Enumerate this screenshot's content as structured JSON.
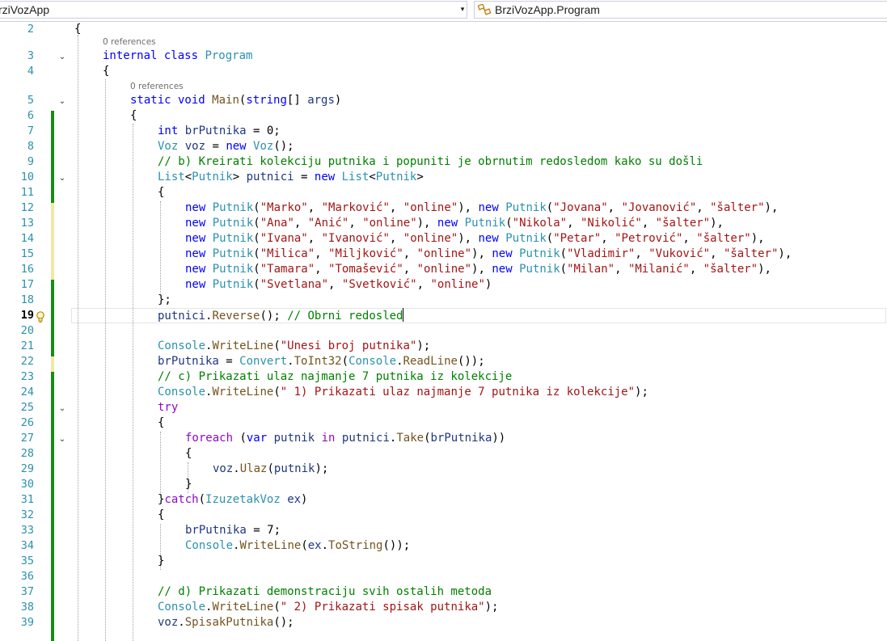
{
  "navbar": {
    "project": "rziVozApp",
    "dropdown_arrow": "▾",
    "class_member": "BrziVozApp.Program",
    "class_icon": "class-icon"
  },
  "codelens": {
    "program_refs": "0 references",
    "main_refs": "0 references"
  },
  "lines": [
    {
      "num": "2",
      "tokens": [
        {
          "t": "{",
          "c": ""
        }
      ]
    },
    {
      "num": "3",
      "tokens": [
        {
          "t": "internal class ",
          "c": "k"
        },
        {
          "t": "Program",
          "c": "t"
        }
      ]
    },
    {
      "num": "4",
      "tokens": [
        {
          "t": "{",
          "c": ""
        }
      ]
    },
    {
      "num": "5",
      "tokens": [
        {
          "t": "static void ",
          "c": "k"
        },
        {
          "t": "Main",
          "c": "m"
        },
        {
          "t": "(",
          "c": ""
        },
        {
          "t": "string",
          "c": "k"
        },
        {
          "t": "[] ",
          "c": ""
        },
        {
          "t": "args",
          "c": "v"
        },
        {
          "t": ")",
          "c": ""
        }
      ]
    },
    {
      "num": "6",
      "tokens": [
        {
          "t": "{",
          "c": ""
        }
      ]
    },
    {
      "num": "7",
      "tokens": [
        {
          "t": "int ",
          "c": "k"
        },
        {
          "t": "brPutnika",
          "c": "v"
        },
        {
          "t": " = 0;",
          "c": ""
        }
      ]
    },
    {
      "num": "8",
      "tokens": [
        {
          "t": "Voz ",
          "c": "t"
        },
        {
          "t": "voz",
          "c": "v"
        },
        {
          "t": " = ",
          "c": ""
        },
        {
          "t": "new ",
          "c": "k"
        },
        {
          "t": "Voz",
          "c": "t"
        },
        {
          "t": "();",
          "c": ""
        }
      ]
    },
    {
      "num": "9",
      "tokens": [
        {
          "t": "// b) Kreirati kolekciju putnika i popuniti je obrnutim redosledom kako su došli",
          "c": "c"
        }
      ]
    },
    {
      "num": "10",
      "tokens": [
        {
          "t": "List",
          "c": "t"
        },
        {
          "t": "<",
          "c": ""
        },
        {
          "t": "Putnik",
          "c": "t"
        },
        {
          "t": "> ",
          "c": ""
        },
        {
          "t": "putnici",
          "c": "v"
        },
        {
          "t": " = ",
          "c": ""
        },
        {
          "t": "new ",
          "c": "k"
        },
        {
          "t": "List",
          "c": "t"
        },
        {
          "t": "<",
          "c": ""
        },
        {
          "t": "Putnik",
          "c": "t"
        },
        {
          "t": ">",
          "c": ""
        }
      ]
    },
    {
      "num": "11",
      "tokens": [
        {
          "t": "{",
          "c": ""
        }
      ]
    },
    {
      "num": "12",
      "tokens": [
        {
          "t": "new ",
          "c": "k"
        },
        {
          "t": "Putnik",
          "c": "t"
        },
        {
          "t": "(",
          "c": ""
        },
        {
          "t": "\"Marko\"",
          "c": "s"
        },
        {
          "t": ", ",
          "c": ""
        },
        {
          "t": "\"Marković\"",
          "c": "s"
        },
        {
          "t": ", ",
          "c": ""
        },
        {
          "t": "\"online\"",
          "c": "s"
        },
        {
          "t": "), ",
          "c": ""
        },
        {
          "t": "new ",
          "c": "k"
        },
        {
          "t": "Putnik",
          "c": "t"
        },
        {
          "t": "(",
          "c": ""
        },
        {
          "t": "\"Jovana\"",
          "c": "s"
        },
        {
          "t": ", ",
          "c": ""
        },
        {
          "t": "\"Jovanović\"",
          "c": "s"
        },
        {
          "t": ", ",
          "c": ""
        },
        {
          "t": "\"šalter\"",
          "c": "s"
        },
        {
          "t": "),",
          "c": ""
        }
      ]
    },
    {
      "num": "13",
      "tokens": [
        {
          "t": "new ",
          "c": "k"
        },
        {
          "t": "Putnik",
          "c": "t"
        },
        {
          "t": "(",
          "c": ""
        },
        {
          "t": "\"Ana\"",
          "c": "s"
        },
        {
          "t": ", ",
          "c": ""
        },
        {
          "t": "\"Anić\"",
          "c": "s"
        },
        {
          "t": ", ",
          "c": ""
        },
        {
          "t": "\"online\"",
          "c": "s"
        },
        {
          "t": "), ",
          "c": ""
        },
        {
          "t": "new ",
          "c": "k"
        },
        {
          "t": "Putnik",
          "c": "t"
        },
        {
          "t": "(",
          "c": ""
        },
        {
          "t": "\"Nikola\"",
          "c": "s"
        },
        {
          "t": ", ",
          "c": ""
        },
        {
          "t": "\"Nikolić\"",
          "c": "s"
        },
        {
          "t": ", ",
          "c": ""
        },
        {
          "t": "\"šalter\"",
          "c": "s"
        },
        {
          "t": "),",
          "c": ""
        }
      ]
    },
    {
      "num": "14",
      "tokens": [
        {
          "t": "new ",
          "c": "k"
        },
        {
          "t": "Putnik",
          "c": "t"
        },
        {
          "t": "(",
          "c": ""
        },
        {
          "t": "\"Ivana\"",
          "c": "s"
        },
        {
          "t": ", ",
          "c": ""
        },
        {
          "t": "\"Ivanović\"",
          "c": "s"
        },
        {
          "t": ", ",
          "c": ""
        },
        {
          "t": "\"online\"",
          "c": "s"
        },
        {
          "t": "), ",
          "c": ""
        },
        {
          "t": "new ",
          "c": "k"
        },
        {
          "t": "Putnik",
          "c": "t"
        },
        {
          "t": "(",
          "c": ""
        },
        {
          "t": "\"Petar\"",
          "c": "s"
        },
        {
          "t": ", ",
          "c": ""
        },
        {
          "t": "\"Petrović\"",
          "c": "s"
        },
        {
          "t": ", ",
          "c": ""
        },
        {
          "t": "\"šalter\"",
          "c": "s"
        },
        {
          "t": "),",
          "c": ""
        }
      ]
    },
    {
      "num": "15",
      "tokens": [
        {
          "t": "new ",
          "c": "k"
        },
        {
          "t": "Putnik",
          "c": "t"
        },
        {
          "t": "(",
          "c": ""
        },
        {
          "t": "\"Milica\"",
          "c": "s"
        },
        {
          "t": ", ",
          "c": ""
        },
        {
          "t": "\"Miljković\"",
          "c": "s"
        },
        {
          "t": ", ",
          "c": ""
        },
        {
          "t": "\"online\"",
          "c": "s"
        },
        {
          "t": "), ",
          "c": ""
        },
        {
          "t": "new ",
          "c": "k"
        },
        {
          "t": "Putnik",
          "c": "t"
        },
        {
          "t": "(",
          "c": ""
        },
        {
          "t": "\"Vladimir\"",
          "c": "s"
        },
        {
          "t": ", ",
          "c": ""
        },
        {
          "t": "\"Vuković\"",
          "c": "s"
        },
        {
          "t": ", ",
          "c": ""
        },
        {
          "t": "\"šalter\"",
          "c": "s"
        },
        {
          "t": "),",
          "c": ""
        }
      ]
    },
    {
      "num": "16",
      "tokens": [
        {
          "t": "new ",
          "c": "k"
        },
        {
          "t": "Putnik",
          "c": "t"
        },
        {
          "t": "(",
          "c": ""
        },
        {
          "t": "\"Tamara\"",
          "c": "s"
        },
        {
          "t": ", ",
          "c": ""
        },
        {
          "t": "\"Tomašević\"",
          "c": "s"
        },
        {
          "t": ", ",
          "c": ""
        },
        {
          "t": "\"online\"",
          "c": "s"
        },
        {
          "t": "), ",
          "c": ""
        },
        {
          "t": "new ",
          "c": "k"
        },
        {
          "t": "Putnik",
          "c": "t"
        },
        {
          "t": "(",
          "c": ""
        },
        {
          "t": "\"Milan\"",
          "c": "s"
        },
        {
          "t": ", ",
          "c": ""
        },
        {
          "t": "\"Milanić\"",
          "c": "s"
        },
        {
          "t": ", ",
          "c": ""
        },
        {
          "t": "\"šalter\"",
          "c": "s"
        },
        {
          "t": "),",
          "c": ""
        }
      ]
    },
    {
      "num": "17",
      "tokens": [
        {
          "t": "new ",
          "c": "k"
        },
        {
          "t": "Putnik",
          "c": "t"
        },
        {
          "t": "(",
          "c": ""
        },
        {
          "t": "\"Svetlana\"",
          "c": "s"
        },
        {
          "t": ", ",
          "c": ""
        },
        {
          "t": "\"Svetković\"",
          "c": "s"
        },
        {
          "t": ", ",
          "c": ""
        },
        {
          "t": "\"online\"",
          "c": "s"
        },
        {
          "t": ")",
          "c": ""
        }
      ]
    },
    {
      "num": "18",
      "tokens": [
        {
          "t": "};",
          "c": ""
        }
      ]
    },
    {
      "num": "19",
      "tokens": [
        {
          "t": "putnici",
          "c": "v"
        },
        {
          "t": ".",
          "c": ""
        },
        {
          "t": "Reverse",
          "c": "m"
        },
        {
          "t": "(); ",
          "c": ""
        },
        {
          "t": "// Obrni redosled",
          "c": "c"
        }
      ]
    },
    {
      "num": "20",
      "tokens": []
    },
    {
      "num": "21",
      "tokens": [
        {
          "t": "Console",
          "c": "t"
        },
        {
          "t": ".",
          "c": ""
        },
        {
          "t": "WriteLine",
          "c": "m"
        },
        {
          "t": "(",
          "c": ""
        },
        {
          "t": "\"Unesi broj putnika\"",
          "c": "s"
        },
        {
          "t": ");",
          "c": ""
        }
      ]
    },
    {
      "num": "22",
      "tokens": [
        {
          "t": "brPutnika",
          "c": "v"
        },
        {
          "t": " = ",
          "c": ""
        },
        {
          "t": "Convert",
          "c": "t"
        },
        {
          "t": ".",
          "c": ""
        },
        {
          "t": "ToInt32",
          "c": "m"
        },
        {
          "t": "(",
          "c": ""
        },
        {
          "t": "Console",
          "c": "t"
        },
        {
          "t": ".",
          "c": ""
        },
        {
          "t": "ReadLine",
          "c": "m"
        },
        {
          "t": "());",
          "c": ""
        }
      ]
    },
    {
      "num": "23",
      "tokens": [
        {
          "t": "// c) Prikazati ulaz najmanje 7 putnika iz kolekcije",
          "c": "c"
        }
      ]
    },
    {
      "num": "24",
      "tokens": [
        {
          "t": "Console",
          "c": "t"
        },
        {
          "t": ".",
          "c": ""
        },
        {
          "t": "WriteLine",
          "c": "m"
        },
        {
          "t": "(",
          "c": ""
        },
        {
          "t": "\" 1) Prikazati ulaz najmanje 7 putnika iz kolekcije\"",
          "c": "s"
        },
        {
          "t": ");",
          "c": ""
        }
      ]
    },
    {
      "num": "25",
      "tokens": [
        {
          "t": "try",
          "c": "ctl"
        }
      ]
    },
    {
      "num": "26",
      "tokens": [
        {
          "t": "{",
          "c": ""
        }
      ]
    },
    {
      "num": "27",
      "tokens": [
        {
          "t": "foreach",
          "c": "ctl"
        },
        {
          "t": " (",
          "c": ""
        },
        {
          "t": "var ",
          "c": "k"
        },
        {
          "t": "putnik",
          "c": "v"
        },
        {
          "t": " ",
          "c": ""
        },
        {
          "t": "in ",
          "c": "ctl"
        },
        {
          "t": "putnici",
          "c": "v"
        },
        {
          "t": ".",
          "c": ""
        },
        {
          "t": "Take",
          "c": "m"
        },
        {
          "t": "(",
          "c": ""
        },
        {
          "t": "brPutnika",
          "c": "v"
        },
        {
          "t": "))",
          "c": ""
        }
      ]
    },
    {
      "num": "28",
      "tokens": [
        {
          "t": "{",
          "c": ""
        }
      ]
    },
    {
      "num": "29",
      "tokens": [
        {
          "t": "voz",
          "c": "v"
        },
        {
          "t": ".",
          "c": ""
        },
        {
          "t": "Ulaz",
          "c": "m"
        },
        {
          "t": "(",
          "c": ""
        },
        {
          "t": "putnik",
          "c": "v"
        },
        {
          "t": ");",
          "c": ""
        }
      ]
    },
    {
      "num": "30",
      "tokens": [
        {
          "t": "}",
          "c": ""
        }
      ]
    },
    {
      "num": "31",
      "tokens": [
        {
          "t": "}",
          "c": ""
        },
        {
          "t": "catch",
          "c": "ctl"
        },
        {
          "t": "(",
          "c": ""
        },
        {
          "t": "IzuzetakVoz ",
          "c": "t"
        },
        {
          "t": "ex",
          "c": "v"
        },
        {
          "t": ")",
          "c": ""
        }
      ]
    },
    {
      "num": "32",
      "tokens": [
        {
          "t": "{",
          "c": ""
        }
      ]
    },
    {
      "num": "33",
      "tokens": [
        {
          "t": "brPutnika",
          "c": "v"
        },
        {
          "t": " = 7;",
          "c": ""
        }
      ]
    },
    {
      "num": "34",
      "tokens": [
        {
          "t": "Console",
          "c": "t"
        },
        {
          "t": ".",
          "c": ""
        },
        {
          "t": "WriteLine",
          "c": "m"
        },
        {
          "t": "(",
          "c": ""
        },
        {
          "t": "ex",
          "c": "v"
        },
        {
          "t": ".",
          "c": ""
        },
        {
          "t": "ToString",
          "c": "m"
        },
        {
          "t": "());",
          "c": ""
        }
      ]
    },
    {
      "num": "35",
      "tokens": [
        {
          "t": "}",
          "c": ""
        }
      ]
    },
    {
      "num": "36",
      "tokens": []
    },
    {
      "num": "37",
      "tokens": [
        {
          "t": "// d) Prikazati demonstraciju svih ostalih metoda",
          "c": "c"
        }
      ]
    },
    {
      "num": "38",
      "tokens": [
        {
          "t": "Console",
          "c": "t"
        },
        {
          "t": ".",
          "c": ""
        },
        {
          "t": "WriteLine",
          "c": "m"
        },
        {
          "t": "(",
          "c": ""
        },
        {
          "t": "\" 2) Prikazati spisak putnika\"",
          "c": "s"
        },
        {
          "t": ");",
          "c": ""
        }
      ]
    },
    {
      "num": "39",
      "tokens": [
        {
          "t": "voz",
          "c": "v"
        },
        {
          "t": ".",
          "c": ""
        },
        {
          "t": "SpisakPutnika",
          "c": "m"
        },
        {
          "t": "();",
          "c": ""
        }
      ]
    }
  ],
  "current_line": "19",
  "colors": {
    "keyword": "#0000ff",
    "type": "#2b91af",
    "string": "#a31515",
    "comment": "#008000",
    "method": "#74531f",
    "variable": "#1f377f",
    "control": "#8f08c4",
    "change_saved": "#1a8a1a",
    "change_unsaved": "#efe8a6"
  }
}
